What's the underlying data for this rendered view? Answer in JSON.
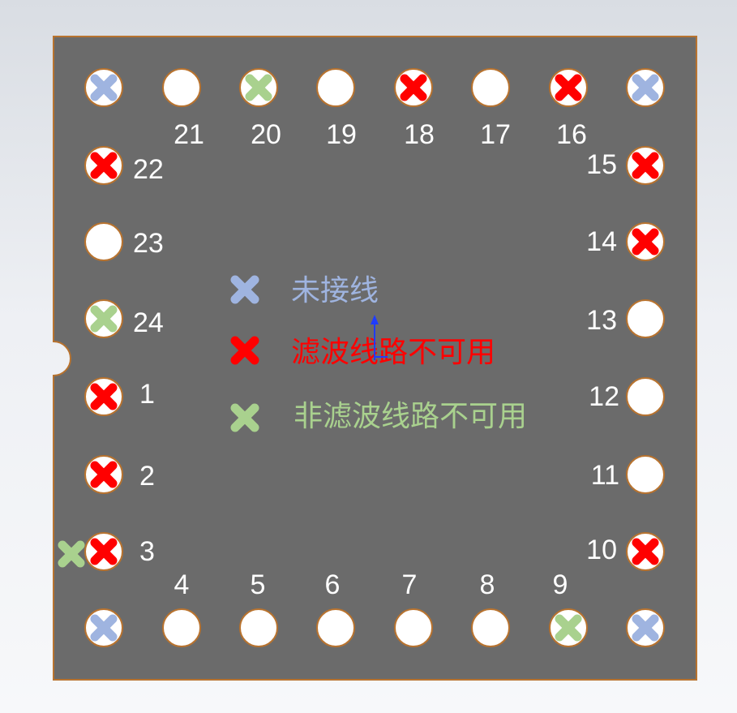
{
  "colors": {
    "board": "#6b6b6b",
    "board_edge": "#b8732f",
    "hole": "#ffffff",
    "unconnected": "#9fb4e0",
    "filtered_unavailable": "#ff0000",
    "nonfiltered_unavailable": "#a9d18e",
    "pin_label": "#ffffff",
    "axis": "#1f3cff"
  },
  "legend": [
    {
      "key": "unconnected",
      "label": "未接线",
      "icon": "x-mark-icon"
    },
    {
      "key": "filtered_unavailable",
      "label": "滤波线路不可用",
      "icon": "x-mark-icon"
    },
    {
      "key": "nonfiltered_unavailable",
      "label": "非滤波线路不可用",
      "icon": "x-mark-icon"
    }
  ],
  "pins": [
    {
      "id": "top-left",
      "label": "",
      "status": "unconnected"
    },
    {
      "id": "21",
      "label": "21",
      "status": "ok"
    },
    {
      "id": "20",
      "label": "20",
      "status": "nonfiltered_unavailable"
    },
    {
      "id": "19",
      "label": "19",
      "status": "ok"
    },
    {
      "id": "18",
      "label": "18",
      "status": "filtered_unavailable"
    },
    {
      "id": "17",
      "label": "17",
      "status": "ok"
    },
    {
      "id": "16",
      "label": "16",
      "status": "filtered_unavailable"
    },
    {
      "id": "top-right",
      "label": "",
      "status": "unconnected"
    },
    {
      "id": "22",
      "label": "22",
      "status": "filtered_unavailable"
    },
    {
      "id": "23",
      "label": "23",
      "status": "ok"
    },
    {
      "id": "24",
      "label": "24",
      "status": "nonfiltered_unavailable"
    },
    {
      "id": "1",
      "label": "1",
      "status": "filtered_unavailable"
    },
    {
      "id": "2",
      "label": "2",
      "status": "filtered_unavailable"
    },
    {
      "id": "3",
      "label": "3",
      "status": "filtered_unavailable"
    },
    {
      "id": "bottom-left",
      "label": "",
      "status": "unconnected"
    },
    {
      "id": "4",
      "label": "4",
      "status": "ok"
    },
    {
      "id": "5",
      "label": "5",
      "status": "ok"
    },
    {
      "id": "6",
      "label": "6",
      "status": "ok"
    },
    {
      "id": "7",
      "label": "7",
      "status": "ok"
    },
    {
      "id": "8",
      "label": "8",
      "status": "ok"
    },
    {
      "id": "9",
      "label": "9",
      "status": "nonfiltered_unavailable"
    },
    {
      "id": "bottom-right",
      "label": "",
      "status": "unconnected"
    },
    {
      "id": "15",
      "label": "15",
      "status": "filtered_unavailable"
    },
    {
      "id": "14",
      "label": "14",
      "status": "filtered_unavailable"
    },
    {
      "id": "13",
      "label": "13",
      "status": "ok"
    },
    {
      "id": "12",
      "label": "12",
      "status": "ok"
    },
    {
      "id": "11",
      "label": "11",
      "status": "ok"
    },
    {
      "id": "10",
      "label": "10",
      "status": "filtered_unavailable"
    }
  ],
  "extra_marks": [
    {
      "id": "pin-3-external",
      "status": "nonfiltered_unavailable",
      "near_pin": "3"
    }
  ]
}
